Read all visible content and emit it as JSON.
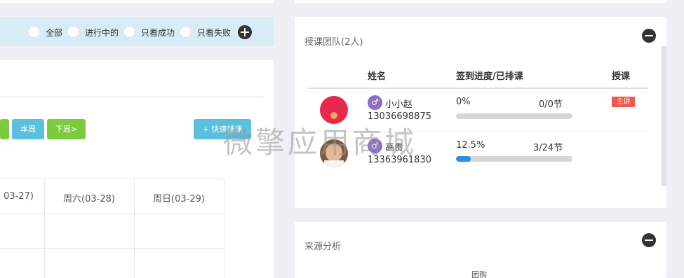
{
  "filter": {
    "options": [
      {
        "label": "全部"
      },
      {
        "label": "进行中的"
      },
      {
        "label": "只看成功"
      },
      {
        "label": "只看失败"
      }
    ]
  },
  "schedule": {
    "buttons": {
      "this_week": "本周",
      "next_week": "下周>",
      "quick_schedule": "+ 快速排课"
    },
    "days": [
      {
        "label": "03-27)"
      },
      {
        "label": "周六(03-28)"
      },
      {
        "label": "周日(03-29)"
      }
    ]
  },
  "team": {
    "title": "授课团队(2人)",
    "headers": {
      "name": "姓名",
      "progress": "签到进度/已排课",
      "role": "授课"
    },
    "members": [
      {
        "name": "小小赵",
        "phone": "13036698875",
        "percent": "0%",
        "lessons": "0/0节",
        "progress": 0,
        "role": "主讲",
        "gender_icon": "♂"
      },
      {
        "name": "高贵",
        "phone": "13363961830",
        "percent": "12.5%",
        "lessons": "3/24节",
        "progress": 0.125,
        "role": "",
        "gender_icon": "♂"
      }
    ]
  },
  "source": {
    "title": "来源分析",
    "chart_label": "团购"
  },
  "watermark": "微擎应用商城",
  "colors": {
    "accent_blue": "#5bc0de",
    "accent_green": "#7bcb3e",
    "progress_fill": "#2a8ff0",
    "badge_red": "#f0584e",
    "filter_bg": "#d8ecf5"
  }
}
